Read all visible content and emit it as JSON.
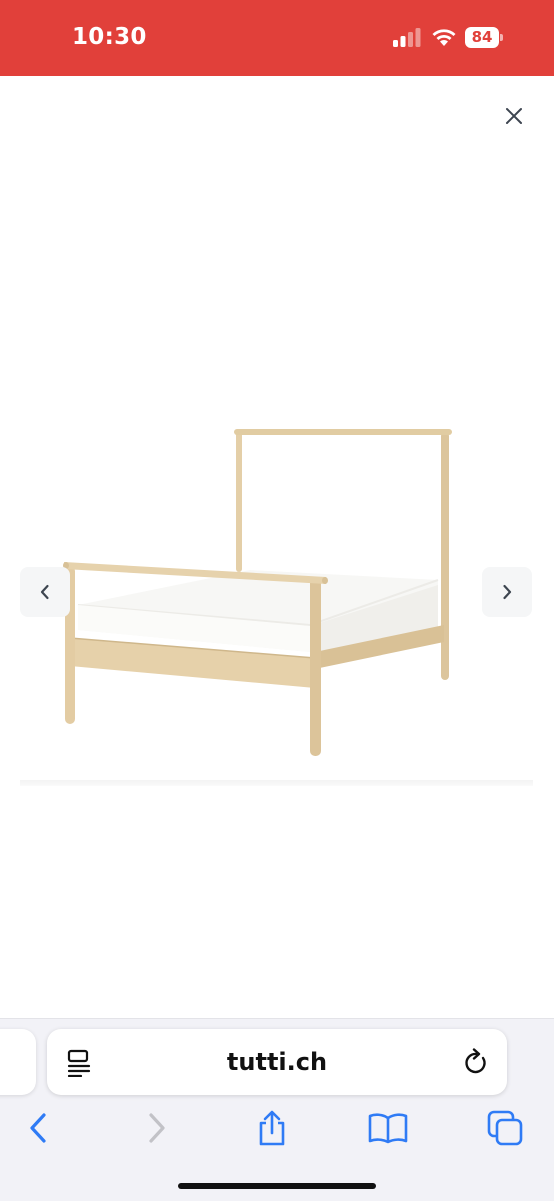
{
  "status_bar": {
    "time": "10:30",
    "battery_level": "84",
    "signal_icon": "cellular-signal-icon",
    "wifi_icon": "wifi-icon",
    "background_color": "#e1403a"
  },
  "gallery": {
    "close_icon": "close-icon",
    "prev_icon": "chevron-left-icon",
    "next_icon": "chevron-right-icon",
    "image": "product-photo-bed-frame"
  },
  "browser": {
    "address": "tutti.ch",
    "reader_icon": "reader-mode-icon",
    "reload_icon": "reload-icon",
    "toolbar": [
      "back-icon",
      "forward-icon",
      "share-icon",
      "bookmarks-icon",
      "tabs-icon"
    ],
    "accent_color": "#2f7bf5"
  }
}
